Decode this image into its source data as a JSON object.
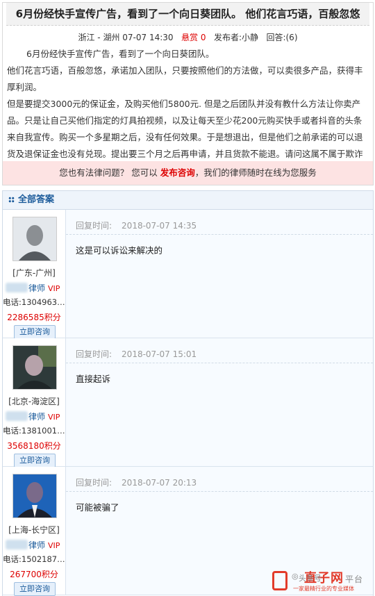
{
  "question": {
    "title": "6月份经快手宣传广告，看到了一个向日葵团队。 他们花言巧语，百般忽悠",
    "location": "浙江 - 湖州",
    "time": "07-07 14:30",
    "reward_label": "悬赏",
    "reward_value": "0",
    "poster_label": "发布者:",
    "poster": "小静",
    "answer_count_label": "回答:",
    "answer_count": "(6)",
    "paragraphs": [
      "6月份经快手宣传广告，看到了一个向日葵团队。",
      "他们花言巧语，百般忽悠，承诺加入团队，只要按照他们的方法做，可以卖很多产品，获得丰厚利润。",
      "但是要提交3000元的保证金，及购买他们5800元. 但是之后团队并没有教什么方法让你卖产品。只是让自己买他们指定的灯具拍视频，以及让每天至少花200元购买快手或者抖音的头条来自我宣传。购买一个多星期之后，没有任何效果。于是想退出，但是他们之前承诺的可以退货及退保证金也没有兑现。提出要三个月之后再申请，并且货款不能退。请问这属不属于欺诈其行为"
    ]
  },
  "banner": {
    "prefix": "您也有法律问题？  您可以 ",
    "link": "发布咨询",
    "suffix": "，我们的律师随时在线为您服务"
  },
  "answers_section": {
    "title": "全部答案",
    "time_label": "回复时间:",
    "lawyer_suffix": "律师",
    "vip": "VIP",
    "phone_label": "电话:",
    "consult_label": "立即咨询",
    "items": [
      {
        "region": "[广东-广州]",
        "phone": "1304963…",
        "score": "2286585积分",
        "time": "2018-07-07  14:35",
        "text": "这是可以诉讼来解决的"
      },
      {
        "region": "[北京-海淀区]",
        "phone": "1381001…",
        "score": "3568180积分",
        "time": "2018-07-07  15:01",
        "text": "直接起诉"
      },
      {
        "region": "[上海-长宁区]",
        "phone": "1502187…",
        "score": "267700积分",
        "time": "2018-07-07  20:13",
        "text": "可能被骗了"
      }
    ]
  },
  "watermark": {
    "wechat": "头条号",
    "brand": "直子网",
    "platform": "平台",
    "tagline": "一家最精行业的专业媒体"
  },
  "colors": {
    "accent_red": "#d00000",
    "link_blue": "#1a5a9a",
    "banner_bg": "#fde3e3"
  }
}
